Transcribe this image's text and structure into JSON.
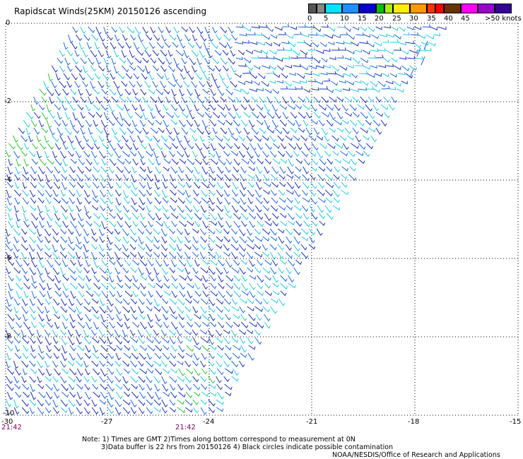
{
  "title": "Rapidscat Winds(25KM) 20150126 ascending",
  "legend": {
    "labels": [
      "0",
      "5",
      "10",
      "15",
      "20",
      "25",
      "30",
      "35",
      "40",
      "45",
      ">50 knots"
    ],
    "colors": [
      "#555555",
      "#00e5ff",
      "#1e90ff",
      "#0000cc",
      "#00c000",
      "#ffee00",
      "#ff9900",
      "#ff3300",
      "#ff0000",
      "#663300",
      "#ff00ff",
      "#9900cc",
      "#330099"
    ]
  },
  "axes": {
    "x_ticks": [
      "-30",
      "-27",
      "-24",
      "-21",
      "-18",
      "-15"
    ],
    "y_ticks": [
      "0",
      "-2",
      "-4",
      "-6",
      "-8",
      "-10"
    ],
    "time_labels": [
      "21:42",
      "21:42"
    ]
  },
  "notes": {
    "line1": "Note: 1) Times are GMT 2)Times along bottom correspond to measurement at 0N",
    "line2": "3)Data buffer is 22 hrs from 20150126 4) Black circles indicate possible contamination"
  },
  "credit": "NOAA/NESDIS/Office of Research and Applications",
  "colors": {
    "grid": "#000000",
    "barb_light": "#22c8e0",
    "barb_mid": "#1e64dc",
    "barb_dark": "#1a30b0",
    "barb_green": "#30c030",
    "time_label": "#7a0060"
  }
}
